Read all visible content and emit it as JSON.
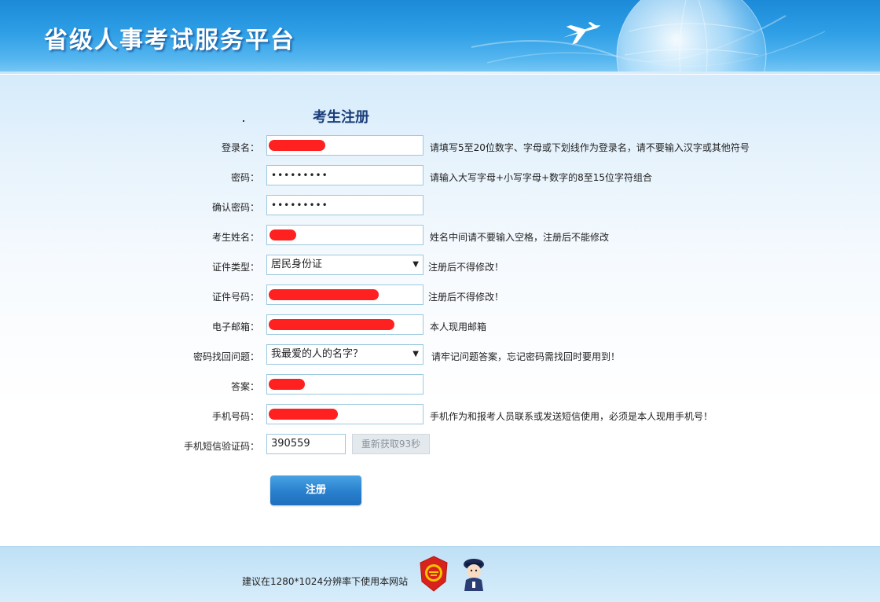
{
  "header": {
    "title": "省级人事考试服务平台"
  },
  "form": {
    "title": "考生注册",
    "login": {
      "label": "登录名：",
      "hint": "请填写5至20位数字、字母或下划线作为登录名，请不要输入汉字或其他符号"
    },
    "password": {
      "label": "密码：",
      "value": "•••••••••",
      "hint": "请输入大写字母+小写字母+数字的8至15位字符组合"
    },
    "confirm": {
      "label": "确认密码：",
      "value": "•••••••••"
    },
    "name": {
      "label": "考生姓名：",
      "hint": "姓名中间请不要输入空格，注册后不能修改"
    },
    "idtype": {
      "label": "证件类型：",
      "value": "居民身份证",
      "hint": "注册后不得修改！"
    },
    "idnum": {
      "label": "证件号码：",
      "hint": "注册后不得修改！"
    },
    "email": {
      "label": "电子邮箱：",
      "hint": "本人现用邮箱"
    },
    "question": {
      "label": "密码找回问题：",
      "value": "我最爱的人的名字？",
      "hint": "请牢记问题答案，忘记密码需找回时要用到！"
    },
    "answer": {
      "label": "答案："
    },
    "phone": {
      "label": "手机号码：",
      "hint": "手机作为和报考人员联系或发送短信使用，必须是本人现用手机号！"
    },
    "sms": {
      "label": "手机短信验证码：",
      "value": "390559",
      "resend": "重新获取93秒"
    },
    "submit": "注册"
  },
  "footer": {
    "text": "建议在1280*1024分辨率下使用本网站"
  }
}
